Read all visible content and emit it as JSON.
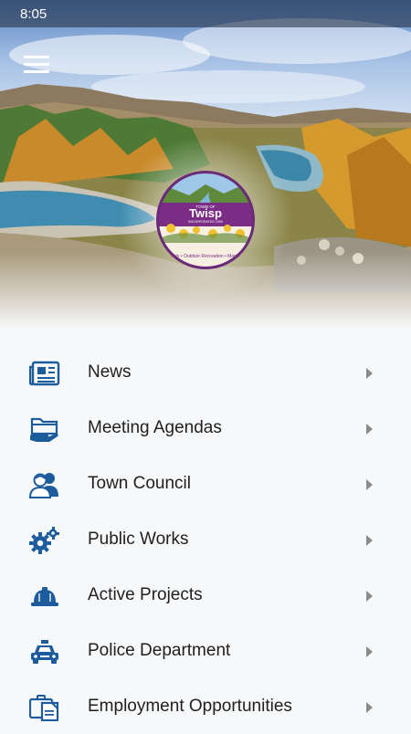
{
  "status_bar": {
    "time": "8:05"
  },
  "logo": {
    "top_text": "TOWN OF",
    "name": "Twisp",
    "incorporated": "INCORPORATED 1909",
    "tagline": "Arts • Outdoor Recreation • Magic"
  },
  "colors": {
    "icon_blue": "#1c5c9c",
    "logo_purple": "#7b2d86",
    "text": "#1f1f1f",
    "chevron": "#8a8a8a"
  },
  "menu": {
    "items": [
      {
        "label": "News",
        "icon": "newspaper-icon"
      },
      {
        "label": "Meeting Agendas",
        "icon": "folder-hand-icon"
      },
      {
        "label": "Town Council",
        "icon": "people-icon"
      },
      {
        "label": "Public Works",
        "icon": "gears-icon"
      },
      {
        "label": "Active Projects",
        "icon": "hard-hat-icon"
      },
      {
        "label": "Police Department",
        "icon": "police-car-icon"
      },
      {
        "label": "Employment Opportunities",
        "icon": "briefcase-document-icon"
      }
    ]
  }
}
